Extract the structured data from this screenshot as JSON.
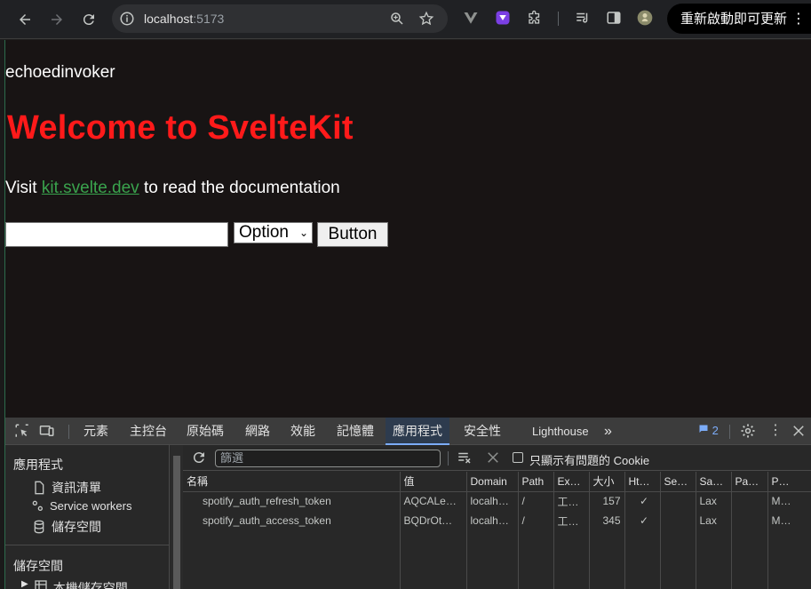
{
  "browser": {
    "url_host": "localhost",
    "url_port": ":5173",
    "update_button": "重新啟動即可更新"
  },
  "page": {
    "username": "echoedinvoker",
    "heading": "Welcome to SvelteKit",
    "visit_prefix": "Visit ",
    "visit_link": "kit.svelte.dev",
    "visit_suffix": " to read the documentation",
    "input_value": "",
    "select_value": "Option",
    "button_label": "Button",
    "colors": {
      "heading": "#ff1a1a",
      "link": "#3aa34d",
      "background": "#181414"
    }
  },
  "devtools": {
    "tabs": [
      "元素",
      "主控台",
      "原始碼",
      "網路",
      "效能",
      "記憶體",
      "應用程式",
      "安全性",
      "Lighthouse"
    ],
    "active_tab": "應用程式",
    "issues_count": "2",
    "sidebar": {
      "section1": "應用程式",
      "items": [
        "資訊清單",
        "Service workers",
        "儲存空間"
      ],
      "section2": "儲存空間",
      "partial_item": "本機儲存空間"
    },
    "filter_placeholder": "篩選",
    "only_issues_label": "只顯示有問題的 Cookie",
    "columns": [
      "名稱",
      "值",
      "Domain",
      "Path",
      "Ex…",
      "大小",
      "Ht…",
      "Se…",
      "Sa…",
      "Pa…",
      "P…"
    ],
    "rows": [
      [
        "spotify_auth_refresh_token",
        "AQCALe…",
        "localh…",
        "/",
        "工…",
        "157",
        "✓",
        "",
        "Lax",
        "",
        "M…"
      ],
      [
        "spotify_auth_access_token",
        "BQDrOt…",
        "localh…",
        "/",
        "工…",
        "345",
        "✓",
        "",
        "Lax",
        "",
        "M…"
      ]
    ]
  }
}
